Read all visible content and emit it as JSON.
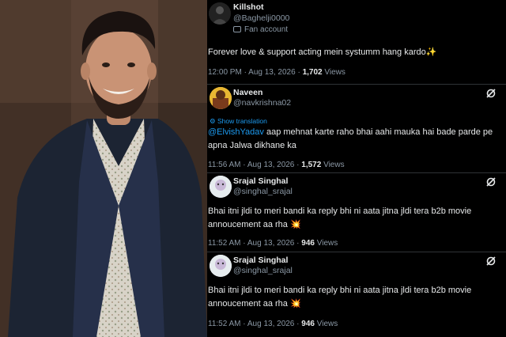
{
  "tweets": [
    {
      "name": "Killshot",
      "handle": "@Baghelji0000",
      "badge": "Fan account",
      "text": "Forever love & support acting mein systumm hang kardo✨",
      "time": "12:00 PM",
      "date": "Aug 13, 2026",
      "views_count": "1,702",
      "views_label": "Views"
    },
    {
      "name": "Naveen",
      "handle": "@navkrishna02",
      "show_translation": "Show translation",
      "mention": "@ElvishYadav",
      "text": "aap mehnat karte raho bhai aahi mauka hai bade parde pe apna Jalwa dikhane ka",
      "time": "11:56 AM",
      "date": "Aug 13, 2026",
      "views_count": "1,572",
      "views_label": "Views"
    },
    {
      "name": "Srajal Singhal",
      "handle": "@singhal_srajal",
      "text": "Bhai itni jldi to meri bandi ka reply bhi ni aata jitna jldi tera b2b movie annoucement aa rha 💥",
      "time": "11:52 AM",
      "date": "Aug 13, 2026",
      "views_count": "946",
      "views_label": "Views"
    },
    {
      "name": "Srajal Singhal",
      "handle": "@singhal_srajal",
      "text": "Bhai itni jldi to meri bandi ka reply bhi ni aata jitna jldi tera b2b movie annoucement aa rha 💥",
      "time": "11:52 AM",
      "date": "Aug 13, 2026",
      "views_count": "946",
      "views_label": "Views"
    }
  ],
  "meta_sep": "·",
  "colors": {
    "background": "#000000",
    "text": "#e7e9ea",
    "muted": "#8b98a5",
    "link": "#1d9bf0",
    "divider": "#2f3336"
  },
  "icons": [
    "grok-icon",
    "fan-account-icon",
    "translate-icon",
    "avatar"
  ]
}
